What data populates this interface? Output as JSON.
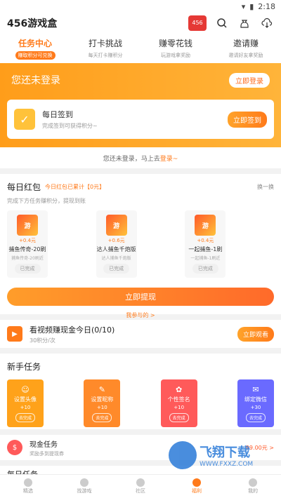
{
  "status": {
    "time": "2:18"
  },
  "app": {
    "title": "456游戏盒"
  },
  "tabs": [
    {
      "label": "任务中心",
      "sub": "赚取积分可兑换",
      "active": true
    },
    {
      "label": "打卡挑战",
      "sub": "每天打卡赚积分",
      "active": false
    },
    {
      "label": "赚零花钱",
      "sub": "玩游戏拿奖励",
      "active": false
    },
    {
      "label": "邀请赚",
      "sub": "邀请好友拿奖励",
      "active": false
    }
  ],
  "hero": {
    "nologin": "您还未登录",
    "login_btn": "立即登录"
  },
  "sign": {
    "title": "每日签到",
    "desc": "完成签到可获得积分~",
    "btn": "立即签到"
  },
  "login_hint": {
    "text": "您还未登录，马上去",
    "link": "登录~"
  },
  "redpack": {
    "title": "每日红包",
    "sub": "今日红包已累计【0元】",
    "refresh": "换一换",
    "desc": "完成下方任务赚积分，提现到账",
    "games": [
      {
        "img": "游",
        "amount": "+0.4元",
        "name": "捕鱼传奇-20刷",
        "sub": "捕鱼传奇-20刷近",
        "status": "已完成"
      },
      {
        "img": "游",
        "amount": "+0.6元",
        "name": "达人捕鱼千炮版",
        "sub": "达人捕鱼千炮版",
        "status": "已完成"
      },
      {
        "img": "游",
        "amount": "+0.4元",
        "name": "一起捕鱼-1刷",
        "sub": "一起捕鱼-1刷近",
        "status": "已完成"
      }
    ],
    "withdraw": "立即提现",
    "myreward": "我参与的 >"
  },
  "video": {
    "title": "看视频赚现金今日(0/10)",
    "sub": "30积分/次",
    "btn": "立即观看"
  },
  "newbie": {
    "title": "新手任务",
    "tasks": [
      {
        "name": "设置头像",
        "points": "+10",
        "btn": "去完成",
        "color": "#ffa21a"
      },
      {
        "name": "设置昵称",
        "points": "+10",
        "btn": "去完成",
        "color": "#ff8a2a"
      },
      {
        "name": "个性签名",
        "points": "+10",
        "btn": "去完成",
        "color": "#ff5a5a"
      },
      {
        "name": "绑定微信",
        "points": "+30",
        "btn": "去完成",
        "color": "#6a6aff"
      }
    ]
  },
  "cash": {
    "title": "现金任务",
    "sub": "奖励多到提现券",
    "amount": "99.00元 >"
  },
  "daily": {
    "title": "每日任务"
  },
  "nav": [
    {
      "label": "精选",
      "active": false
    },
    {
      "label": "找游戏",
      "active": false
    },
    {
      "label": "社区",
      "active": false
    },
    {
      "label": "福利",
      "active": true
    },
    {
      "label": "我的",
      "active": false
    }
  ],
  "watermark": {
    "w1": "飞翔下载",
    "w2": "WWW.FXXZ.COM"
  }
}
